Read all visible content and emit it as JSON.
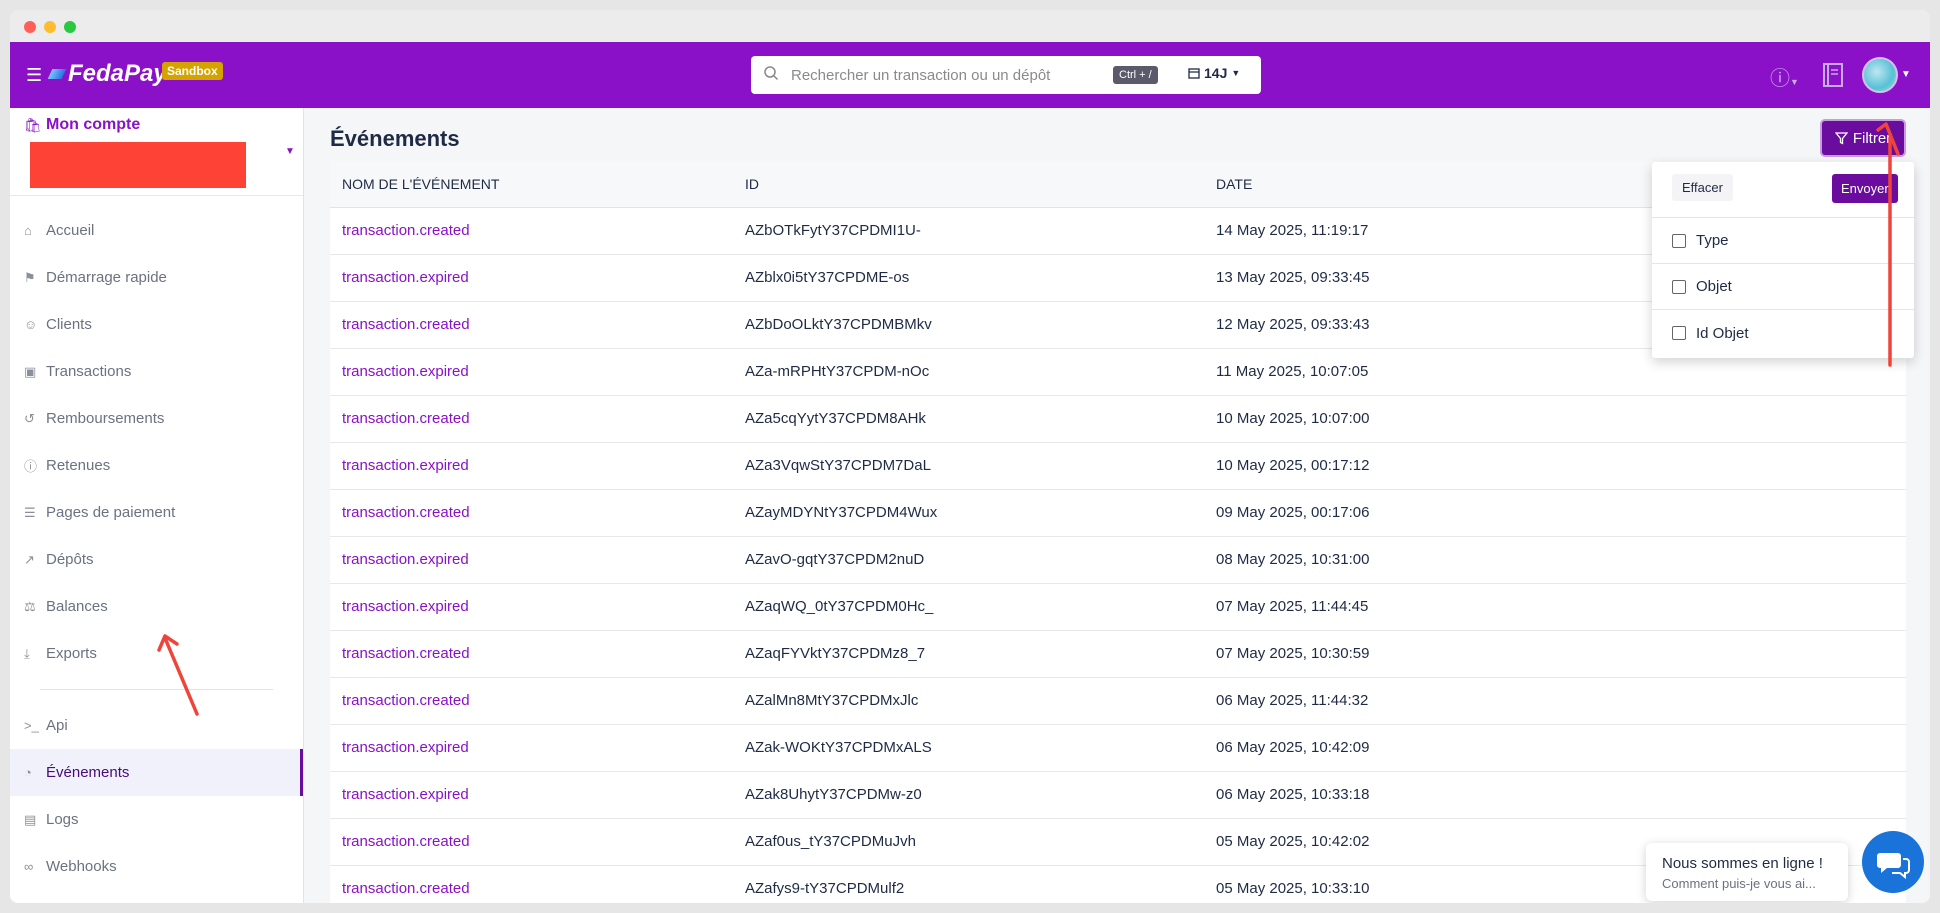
{
  "window": {
    "controls": [
      "close",
      "minimize",
      "maximize"
    ]
  },
  "topbar": {
    "menu_icon": "hamburger-icon",
    "brand": "FedaPay",
    "env_badge": "Sandbox",
    "search": {
      "placeholder": "Rechercher un transaction ou un dépôt",
      "shortcut": "Ctrl + /",
      "period": "14J"
    },
    "accent": "#8a11c7"
  },
  "account": {
    "title": "Mon compte"
  },
  "sidebar": {
    "items": [
      {
        "label": "Accueil",
        "icon": "home-icon",
        "active": false
      },
      {
        "label": "Démarrage rapide",
        "icon": "flag-icon",
        "active": false
      },
      {
        "label": "Clients",
        "icon": "user-icon",
        "active": false
      },
      {
        "label": "Transactions",
        "icon": "money-icon",
        "active": false
      },
      {
        "label": "Remboursements",
        "icon": "refund-icon",
        "active": false
      },
      {
        "label": "Retenues",
        "icon": "info-icon",
        "active": false
      },
      {
        "label": "Pages de paiement",
        "icon": "page-icon",
        "active": false
      },
      {
        "label": "Dépôts",
        "icon": "external-icon",
        "active": false
      },
      {
        "label": "Balances",
        "icon": "scale-icon",
        "active": false
      },
      {
        "label": "Exports",
        "icon": "download-icon",
        "active": false
      },
      {
        "label": "Api",
        "icon": "terminal-icon",
        "active": false
      },
      {
        "label": "Événements",
        "icon": "rss-icon",
        "active": true
      },
      {
        "label": "Logs",
        "icon": "file-icon",
        "active": false
      },
      {
        "label": "Webhooks",
        "icon": "link-icon",
        "active": false
      }
    ]
  },
  "main": {
    "title": "Événements",
    "filter_label": "Filtrer",
    "table": {
      "headers": [
        "NOM DE L'ÉVÉNEMENT",
        "ID",
        "DATE"
      ],
      "rows": [
        [
          "transaction.created",
          "AZbOTkFytY37CPDMI1U-",
          "14 May 2025, 11:19:17"
        ],
        [
          "transaction.expired",
          "AZblx0i5tY37CPDME-os",
          "13 May 2025, 09:33:45"
        ],
        [
          "transaction.created",
          "AZbDoOLktY37CPDMBMkv",
          "12 May 2025, 09:33:43"
        ],
        [
          "transaction.expired",
          "AZa-mRPHtY37CPDM-nOc",
          "11 May 2025, 10:07:05"
        ],
        [
          "transaction.created",
          "AZa5cqYytY37CPDM8AHk",
          "10 May 2025, 10:07:00"
        ],
        [
          "transaction.expired",
          "AZa3VqwStY37CPDM7DaL",
          "10 May 2025, 00:17:12"
        ],
        [
          "transaction.created",
          "AZayMDYNtY37CPDM4Wux",
          "09 May 2025, 00:17:06"
        ],
        [
          "transaction.expired",
          "AZavO-gqtY37CPDM2nuD",
          "08 May 2025, 10:31:00"
        ],
        [
          "transaction.expired",
          "AZaqWQ_0tY37CPDM0Hc_",
          "07 May 2025, 11:44:45"
        ],
        [
          "transaction.created",
          "AZaqFYVktY37CPDMz8_7",
          "07 May 2025, 10:30:59"
        ],
        [
          "transaction.created",
          "AZalMn8MtY37CPDMxJlc",
          "06 May 2025, 11:44:32"
        ],
        [
          "transaction.expired",
          "AZak-WOKtY37CPDMxALS",
          "06 May 2025, 10:42:09"
        ],
        [
          "transaction.expired",
          "AZak8UhytY37CPDMw-z0",
          "06 May 2025, 10:33:18"
        ],
        [
          "transaction.created",
          "AZaf0us_tY37CPDMuJvh",
          "05 May 2025, 10:42:02"
        ],
        [
          "transaction.created",
          "AZafys9-tY37CPDMulf2",
          "05 May 2025, 10:33:10"
        ]
      ]
    }
  },
  "filter_dropdown": {
    "clear_label": "Effacer",
    "send_label": "Envoyer",
    "options": [
      "Type",
      "Objet",
      "Id Objet"
    ]
  },
  "chat": {
    "title": "Nous sommes en ligne !",
    "subtitle": "Comment puis-je vous ai..."
  }
}
